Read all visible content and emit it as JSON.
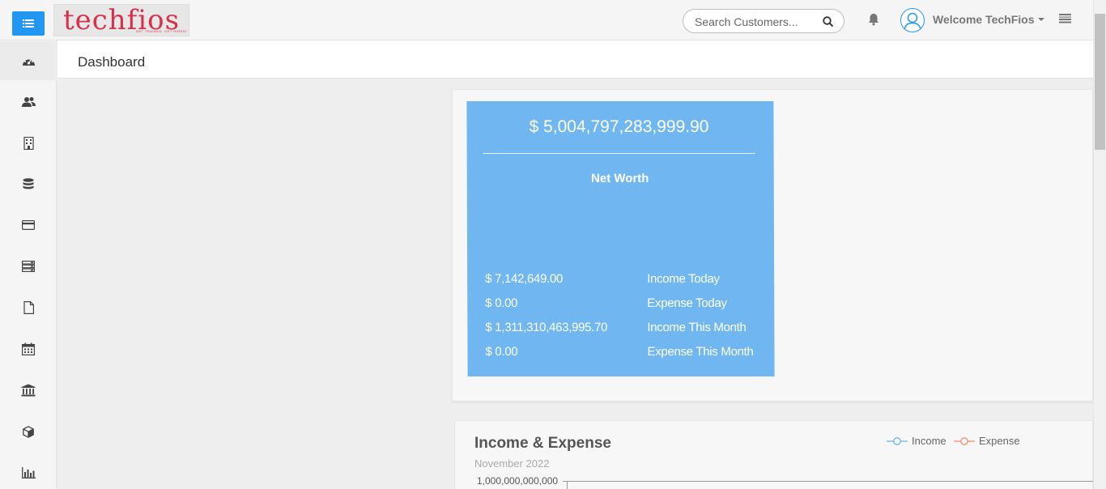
{
  "header": {
    "logo_text": "techfios",
    "logo_tagline": "GET TRAINED. GET HIRED!",
    "search_placeholder": "Search Customers...",
    "welcome_text": "Welcome TechFios"
  },
  "sidebar": {
    "items": [
      {
        "icon": "dashboard-icon"
      },
      {
        "icon": "users-icon"
      },
      {
        "icon": "building-icon"
      },
      {
        "icon": "database-icon"
      },
      {
        "icon": "credit-card-icon"
      },
      {
        "icon": "server-list-icon"
      },
      {
        "icon": "file-icon"
      },
      {
        "icon": "calendar-icon"
      },
      {
        "icon": "bank-icon"
      },
      {
        "icon": "cube-icon"
      },
      {
        "icon": "bar-chart-icon"
      }
    ]
  },
  "page": {
    "title": "Dashboard"
  },
  "networth": {
    "value": "$ 5,004,797,283,999.90",
    "label": "Net Worth",
    "stats": [
      {
        "value": "$ 7,142,649.00",
        "label": "Income Today"
      },
      {
        "value": "$ 0.00",
        "label": "Expense Today"
      },
      {
        "value": "$ 1,311,310,463,995.70",
        "label": "Income This Month"
      },
      {
        "value": "$ 0.00",
        "label": "Expense This Month"
      }
    ]
  },
  "chart": {
    "title": "Income & Expense",
    "subtitle": "November 2022",
    "legend": [
      {
        "name": "Income",
        "color": "#6fb3ea"
      },
      {
        "name": "Expense",
        "color": "#f08a6b"
      }
    ],
    "ytick_top": "1,000,000,000,000"
  },
  "colors": {
    "accent": "#2196f3",
    "card": "#70b6f1"
  }
}
